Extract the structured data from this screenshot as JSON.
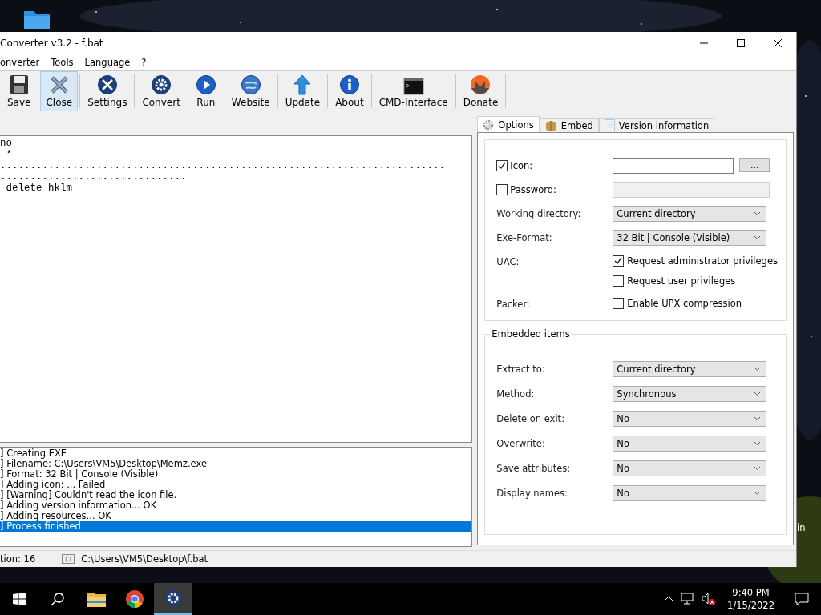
{
  "window": {
    "title": "Converter v3.2 - f.bat"
  },
  "menu": [
    "onverter",
    "Tools",
    "Language",
    "?"
  ],
  "toolbar": [
    {
      "kind": "save",
      "label": "Save",
      "selected": false
    },
    {
      "kind": "close",
      "label": "Close",
      "selected": true
    },
    {
      "kind": "settings",
      "label": "Settings",
      "selected": false
    },
    {
      "kind": "convert",
      "label": "Convert",
      "selected": false
    },
    {
      "kind": "run",
      "label": "Run",
      "selected": false
    },
    {
      "kind": "website",
      "label": "Website",
      "selected": false
    },
    {
      "kind": "update",
      "label": "Update",
      "selected": false
    },
    {
      "kind": "about",
      "label": "About",
      "selected": false
    },
    {
      "kind": "cmd",
      "label": "CMD-Interface",
      "selected": false
    },
    {
      "kind": "donate",
      "label": "Donate",
      "selected": false
    }
  ],
  "editor_lines": [
    "no",
    " *",
    "..........................................................................",
    "...............................",
    " delete hklm"
  ],
  "log": [
    {
      "text": "] Creating EXE",
      "selected": false
    },
    {
      "text": "] Filename: C:\\Users\\VM5\\Desktop\\Memz.exe",
      "selected": false
    },
    {
      "text": "] Format: 32 Bit | Console (Visible)",
      "selected": false
    },
    {
      "text": "] Adding icon: ... Failed",
      "selected": false
    },
    {
      "text": "] [Warning] Couldn't read the icon file.",
      "selected": false
    },
    {
      "text": "] Adding version information... OK",
      "selected": false
    },
    {
      "text": "] Adding resources... OK",
      "selected": false
    },
    {
      "text": "] Process finished",
      "selected": true
    }
  ],
  "tabs": [
    {
      "kind": "gear",
      "label": "Options",
      "selected": true
    },
    {
      "kind": "box",
      "label": "Embed",
      "selected": false
    },
    {
      "kind": "doc",
      "label": "Version information",
      "selected": false
    }
  ],
  "options": [
    {
      "kind": "check-input",
      "label": "Icon:",
      "checked": true,
      "disabled": false,
      "button": "..."
    },
    {
      "kind": "check-input",
      "label": "Password:",
      "checked": false,
      "disabled": true
    },
    {
      "kind": "select",
      "label": "Working directory:",
      "value": "Current directory"
    },
    {
      "kind": "select",
      "label": "Exe-Format:",
      "value": "32 Bit | Console (Visible)"
    },
    {
      "kind": "checks",
      "label": "UAC:",
      "items": [
        {
          "label": "Request administrator privileges",
          "checked": true
        },
        {
          "label": "Request user privileges",
          "checked": false
        }
      ]
    },
    {
      "kind": "checks",
      "label": "Packer:",
      "items": [
        {
          "label": "Enable UPX compression",
          "checked": false
        }
      ]
    }
  ],
  "embedded": {
    "title": "Embedded items",
    "rows": [
      {
        "label": "Extract to:",
        "value": "Current directory"
      },
      {
        "label": "Method:",
        "value": "Synchronous"
      },
      {
        "label": "Delete on exit:",
        "value": "No"
      },
      {
        "label": "Overwrite:",
        "value": "No"
      },
      {
        "label": "Save attributes:",
        "value": "No"
      },
      {
        "label": "Display names:",
        "value": "No"
      }
    ]
  },
  "status_bar": {
    "position": "tion: 16",
    "path": "C:\\Users\\VM5\\Desktop\\f.bat"
  },
  "desktop_text": "in",
  "taskbar": {
    "time": "9:40 PM",
    "date": "1/15/2022"
  }
}
